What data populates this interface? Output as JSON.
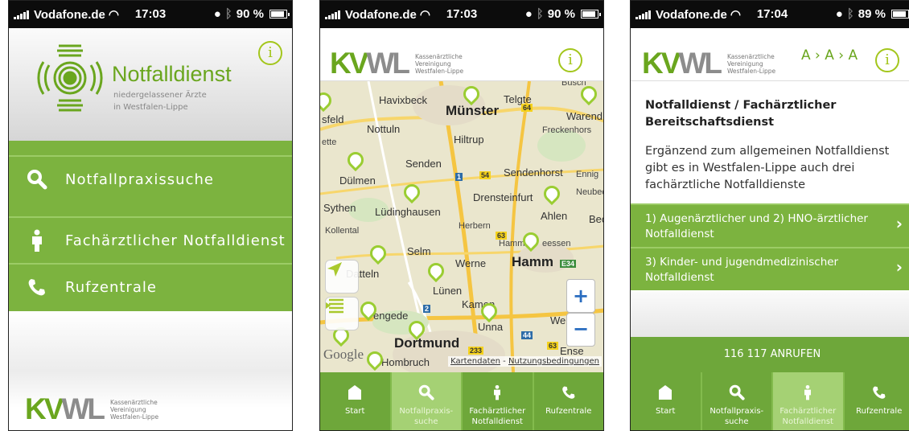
{
  "status_bars": [
    {
      "carrier": "Vodafone.de",
      "time": "17:03",
      "battery": "90 %",
      "battery_level": 0.9
    },
    {
      "carrier": "Vodafone.de",
      "time": "17:03",
      "battery": "90 %",
      "battery_level": 0.9
    },
    {
      "carrier": "Vodafone.de",
      "time": "17:04",
      "battery": "89 %",
      "battery_level": 0.89
    }
  ],
  "colors": {
    "brand_green": "#7cb33f",
    "tab_green": "#6ea73a",
    "active_tab": "#a5d174",
    "lime": "#a3c61c"
  },
  "info_label": "i",
  "logo": {
    "kv": "KV",
    "wl": "WL",
    "sub": [
      "Kassenärztliche",
      "Vereinigung",
      "Westfalen-Lippe"
    ]
  },
  "screen1": {
    "title": "Notfalldienst",
    "subtitle_line1": "niedergelassener Ärzte",
    "subtitle_line2": "in Westfalen-Lippe",
    "menu": [
      {
        "label": "Notfallpraxissuche",
        "icon": "search-icon"
      },
      {
        "label": "Fachärztlicher Notfalldienst",
        "icon": "doctor-icon"
      },
      {
        "label": "Rufzentrale",
        "icon": "phone-icon"
      }
    ]
  },
  "screen2": {
    "towns": {
      "busch": "Busch",
      "havixbeck": "Havixbeck",
      "munster": "Münster",
      "telgte": "Telgte",
      "warend": "Warend",
      "sfeld": "sfeld",
      "nottuln": "Nottuln",
      "freckenhors": "Freckenhors",
      "hiltrup": "Hiltrup",
      "ette": "ette",
      "senden": "Senden",
      "sendenhorst": "Sendenhorst",
      "ennig": "Ennig",
      "dulmen": "Dülmen",
      "neubec": "Neubec",
      "sythen": "Sythen",
      "ludinghausen": "Lüdinghausen",
      "drensteinfurt": "Drensteinfurt",
      "ahlen": "Ahlen",
      "bec": "Bec",
      "herbern": "Herbern",
      "kollental": "Kollental",
      "selm": "Selm",
      "hamm_heessen": "Hamm",
      "eessen": "eessen",
      "werne": "Werne",
      "hamm": "Hamm",
      "datteln": "Datteln",
      "lunen": "Lünen",
      "kamen": "Kamen",
      "we": "We",
      "mengede": "engede",
      "unna": "Unna",
      "dortmund": "Dortmund",
      "hombruch": "Hombruch",
      "ense": "Ense"
    },
    "road_labels": [
      "64",
      "1",
      "54",
      "63",
      "2",
      "44",
      "63",
      "E34",
      "233"
    ],
    "google": "Google",
    "attribution_data": "Kartendaten",
    "attribution_sep": " - ",
    "attribution_terms": "Nutzungsbedingungen",
    "zoom_in": "+",
    "zoom_out": "−"
  },
  "screen3": {
    "font_size_control": "A › A › A",
    "heading": "Notfalldienst / Fachärztlicher Bereitschaftsdienst",
    "intro": "Ergänzend zum allgemeinen Notfalldienst gibt es in Westfalen-Lippe auch drei fachärztliche Notfalldienste",
    "links": [
      {
        "label": "1) Augenärztlicher und 2) HNO-ärztlicher Notfalldienst"
      },
      {
        "label": "3) Kinder- und jugendmedizinischer Notfalldienst"
      }
    ],
    "chevron": "›",
    "call_button": "116 117 ANRUFEN"
  },
  "tabs": [
    {
      "line1": "Start",
      "line2": "",
      "icon": "home-icon"
    },
    {
      "line1": "Notfallpraxis-",
      "line2": "suche",
      "icon": "search-icon"
    },
    {
      "line1": "Fachärztlicher",
      "line2": "Notfalldienst",
      "icon": "doctor-icon"
    },
    {
      "line1": "Rufzentrale",
      "line2": "",
      "icon": "phone-icon"
    }
  ]
}
